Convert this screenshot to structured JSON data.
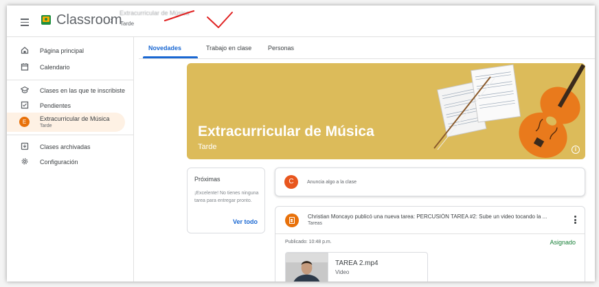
{
  "header": {
    "app_name": "Classroom",
    "separator": "›",
    "class_name": "Extracurricular de Música",
    "section": "Tarde"
  },
  "tabs": [
    {
      "label": "Novedades",
      "active": true
    },
    {
      "label": "Trabajo en clase",
      "active": false
    },
    {
      "label": "Personas",
      "active": false
    }
  ],
  "sidebar": {
    "items": [
      {
        "label": "Página principal",
        "icon": "home-icon"
      },
      {
        "label": "Calendario",
        "icon": "calendar-icon"
      },
      {
        "label": "Clases en las que te inscribiste",
        "icon": "school-icon"
      },
      {
        "label": "Pendientes",
        "icon": "todo-icon"
      },
      {
        "label": "Extracurricular de Música",
        "sub": "Tarde",
        "initial": "E",
        "active": true
      },
      {
        "label": "Clases archivadas",
        "icon": "archive-icon"
      },
      {
        "label": "Configuración",
        "icon": "gear-icon"
      }
    ]
  },
  "banner": {
    "title": "Extracurricular de Música",
    "subtitle": "Tarde",
    "color": "#dcbb5a"
  },
  "upcoming": {
    "title": "Próximas",
    "text": "¡Excelente! No tienes ninguna tarea para entregar pronto.",
    "link": "Ver todo"
  },
  "announce": {
    "avatar_initial": "C",
    "placeholder": "Anuncia algo a la clase"
  },
  "post": {
    "title": "Christian Moncayo publicó una nueva tarea: PERCUSIÓN TAREA #2: Sube un video tocando la ...",
    "category": "Tareas",
    "published": "Publicado: 10:48 p.m.",
    "status": "Asignado",
    "attachment": {
      "name": "TAREA 2.mp4",
      "type": "Video"
    }
  },
  "colors": {
    "accent": "#1967d2",
    "orange": "#e8710a",
    "status_green": "#188038",
    "annotation_red": "#e02020"
  }
}
